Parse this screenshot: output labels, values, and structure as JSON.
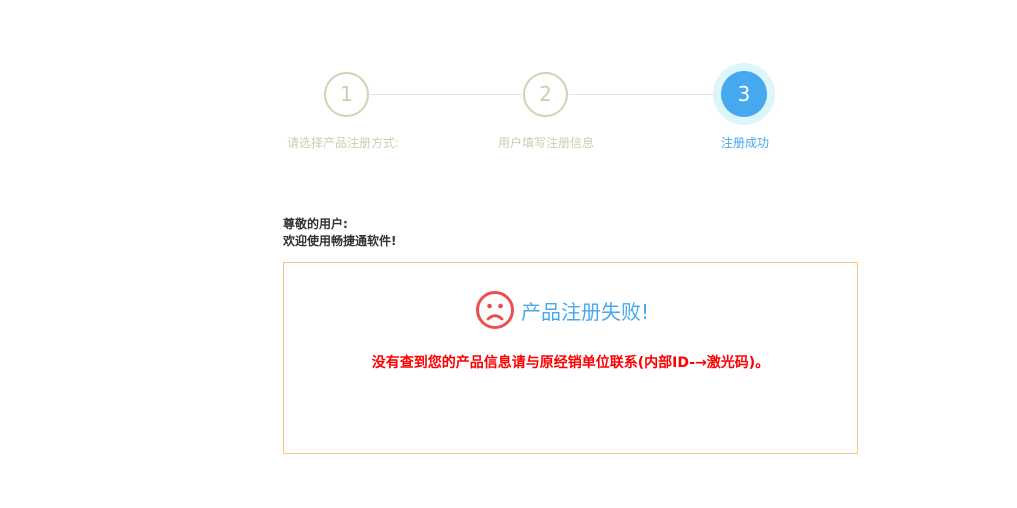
{
  "stepper": {
    "steps": [
      {
        "number": "1",
        "label": "请选择产品注册方式:"
      },
      {
        "number": "2",
        "label": "用户填写注册信息"
      },
      {
        "number": "3",
        "label": "注册成功"
      }
    ],
    "active_step": 3
  },
  "greeting": {
    "line1": "尊敬的用户:",
    "line2": "欢迎使用畅捷通软件!"
  },
  "result": {
    "icon": "sad-face-icon",
    "title": "产品注册失败!",
    "message": "没有查到您的产品信息请与原经销单位联系(内部ID-→激光码)。"
  },
  "colors": {
    "accent": "#46a9ef",
    "inactive": "#cfcbb0",
    "error": "#ff0000",
    "icon_red": "#f04c4c",
    "panel_border": "#f5c77e"
  }
}
